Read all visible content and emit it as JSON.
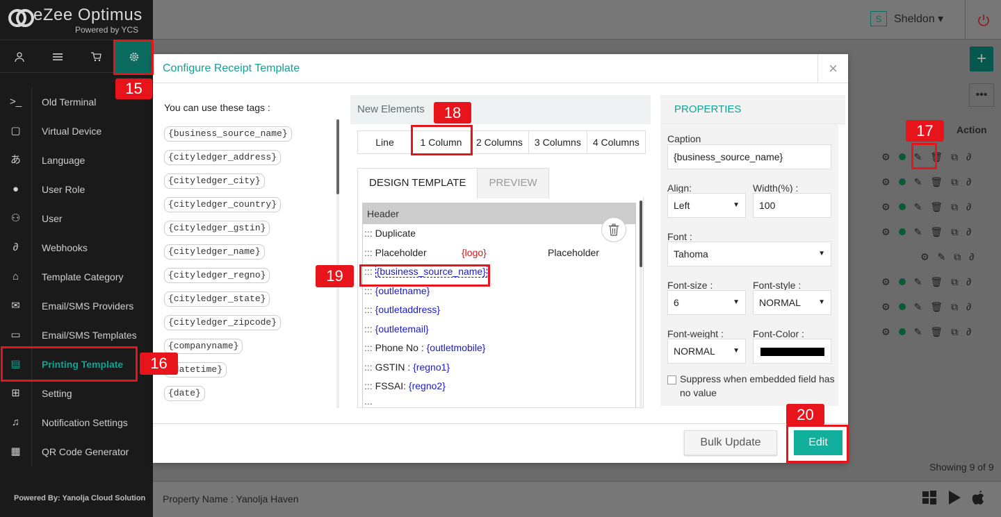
{
  "app": {
    "brand": "eZee Optimus",
    "powered": "Powered by YCS",
    "footer": "Powered By: Yanolja Cloud Solution"
  },
  "user": {
    "initial": "S",
    "name": "Sheldon ▾"
  },
  "topicons": [
    "user-icon",
    "list-icon",
    "cart-icon",
    "gear-icon"
  ],
  "menu": [
    {
      "label": "Old Terminal",
      "icon": ">_"
    },
    {
      "label": "Virtual Device",
      "icon": "▢"
    },
    {
      "label": "Language",
      "icon": "あ"
    },
    {
      "label": "User Role",
      "icon": "●"
    },
    {
      "label": "User",
      "icon": "⚇"
    },
    {
      "label": "Webhooks",
      "icon": "∂"
    },
    {
      "label": "Template Category",
      "icon": "⌂"
    },
    {
      "label": "Email/SMS Providers",
      "icon": "✉"
    },
    {
      "label": "Email/SMS Templates",
      "icon": "▭"
    },
    {
      "label": "Printing Template",
      "icon": "▤"
    },
    {
      "label": "Setting",
      "icon": "⊞"
    },
    {
      "label": "Notification Settings",
      "icon": "♫"
    },
    {
      "label": "QR Code Generator",
      "icon": "▦"
    }
  ],
  "background": {
    "action_header": "Action",
    "showing": "Showing 9 of 9",
    "property": "Property Name : Yanolja Haven"
  },
  "modal": {
    "title": "Configure Receipt Template",
    "close": "×",
    "tags_label": "You can use these tags :",
    "tags": [
      "{business_source_name}",
      "{cityledger_address}",
      "{cityledger_city}",
      "{cityledger_country}",
      "{cityledger_gstin}",
      "{cityledger_name}",
      "{cityledger_regno}",
      "{cityledger_state}",
      "{cityledger_zipcode}",
      "{companyname}",
      "{datetime}",
      "{date}"
    ],
    "new_elements": "New Elements",
    "columns": [
      "Line",
      "1 Column",
      "2 Columns",
      "3 Columns",
      "4 Columns"
    ],
    "tabs": {
      "design": "DESIGN TEMPLATE",
      "preview": "PREVIEW"
    },
    "design": {
      "header": "Header",
      "handle": ":::",
      "rows": {
        "duplicate": "Duplicate",
        "placeholder1": "Placeholder",
        "logo": "{logo}",
        "placeholder2": "Placeholder",
        "business": "{business_source_name}",
        "outletname": "{outletname}",
        "outletaddress": "{outletaddress}",
        "outletemail": "{outletemail}",
        "phone_label": "Phone No :",
        "outletmobile": "{outletmobile}",
        "gstin_label": "GSTIN :",
        "regno1": "{regno1}",
        "fssai_label": "FSSAI:",
        "regno2": "{regno2}"
      }
    },
    "properties": {
      "title": "PROPERTIES",
      "caption_label": "Caption",
      "caption_value": "{business_source_name}",
      "align_label": "Align:",
      "align_value": "Left",
      "width_label": "Width(%) :",
      "width_value": "100",
      "font_label": "Font :",
      "font_value": "Tahoma",
      "fontsize_label": "Font-size :",
      "fontsize_value": "6",
      "fontstyle_label": "Font-style :",
      "fontstyle_value": "NORMAL",
      "fontweight_label": "Font-weight :",
      "fontweight_value": "NORMAL",
      "fontcolor_label": "Font-Color :",
      "font_color": "#000000",
      "suppress_label": "Suppress when embedded field has no value"
    },
    "buttons": {
      "bulk": "Bulk Update",
      "edit": "Edit"
    }
  },
  "annotations": [
    "15",
    "16",
    "17",
    "18",
    "19",
    "20"
  ],
  "colors": {
    "accent": "#12b09c",
    "sidebar": "#1a1a1a",
    "annotation": "#e8141b",
    "tag_blue": "#1a1acc",
    "tag_red": "#e0161b"
  }
}
